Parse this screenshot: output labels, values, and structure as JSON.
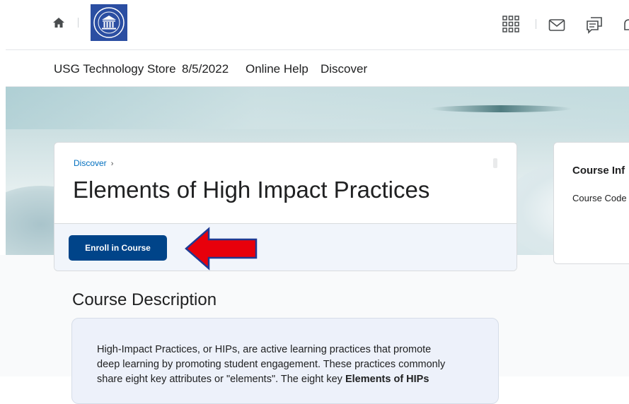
{
  "header": {
    "home_icon": "home-icon",
    "logo_alt": "University System of Georgia seal",
    "icons": [
      "grid-icon",
      "mail-icon",
      "chat-icon",
      "bell-icon"
    ]
  },
  "nav": {
    "items": [
      {
        "label": "USG Technology Store"
      },
      {
        "label": "8/5/2022"
      },
      {
        "label": "Online Help"
      },
      {
        "label": "Discover"
      }
    ]
  },
  "course": {
    "breadcrumb": "Discover",
    "title": "Elements of High Impact Practices",
    "enroll_label": "Enroll in Course"
  },
  "info_card": {
    "title": "Course Inf",
    "course_code_label": "Course Code"
  },
  "description": {
    "heading": "Course Description",
    "line1": "High-Impact Practices, or HIPs, are active learning practices that promote",
    "line2": "deep learning by promoting student engagement. These practices commonly",
    "line3_start": "share eight key attributes or \"elements\". The eight key ",
    "line3_bold": "Elements of HIPs"
  },
  "colors": {
    "accent": "#004489",
    "link": "#006fbf",
    "arrow": "#e8000b",
    "logo_bg": "#2b4ea2"
  }
}
